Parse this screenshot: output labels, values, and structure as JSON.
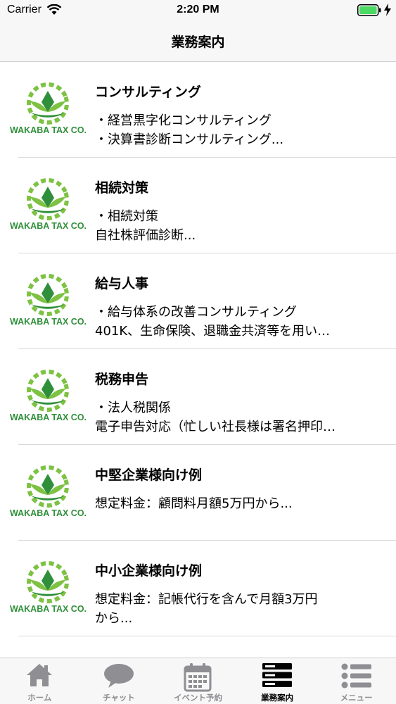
{
  "status_bar": {
    "carrier": "Carrier",
    "time": "2:20 PM"
  },
  "nav": {
    "title": "業務案内"
  },
  "services": [
    {
      "logo_text": "WAKABA TAX CO.",
      "title": "コンサルティング",
      "body": "・経営黒字化コンサルティング\n・決算書診断コンサルティング..."
    },
    {
      "logo_text": "WAKABA TAX CO.",
      "title": "相続対策",
      "body": "・相続対策\n自社株評価診断..."
    },
    {
      "logo_text": "WAKABA TAX CO.",
      "title": "給与人事",
      "body": "・給与体系の改善コンサルティング\n401K、生命保険、退職金共済等を用い…"
    },
    {
      "logo_text": "WAKABA TAX CO.",
      "title": "税務申告",
      "body": "・法人税関係\n電子申告対応（忙しい社長様は署名押印…"
    },
    {
      "logo_text": "WAKABA TAX CO.",
      "title": "中堅企業様向け例",
      "body": "想定料金：顧問料月額5万円から..."
    },
    {
      "logo_text": "WAKABA TAX CO.",
      "title": "中小企業様向け例",
      "body": "想定料金：記帳代行を含んで月額3万円\nから..."
    }
  ],
  "tabs": [
    {
      "label": "ホーム",
      "icon": "home-icon"
    },
    {
      "label": "チャット",
      "icon": "chat-bubble-icon"
    },
    {
      "label": "イベント予約",
      "icon": "calendar-icon"
    },
    {
      "label": "業務案内",
      "icon": "server-list-icon",
      "active": true
    },
    {
      "label": "メニュー",
      "icon": "menu-list-icon"
    }
  ],
  "colors": {
    "brand_green": "#2f8f3a",
    "light_green": "#7dc242",
    "battery_green": "#4cd964",
    "tab_inactive": "#8e8e93"
  }
}
